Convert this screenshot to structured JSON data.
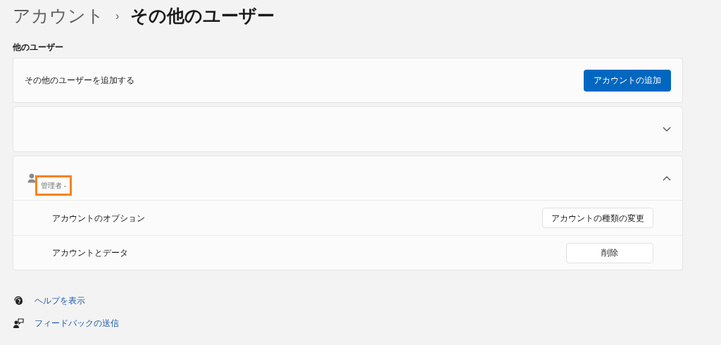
{
  "breadcrumb": {
    "parent": "アカウント",
    "separator": "›",
    "current": "その他のユーザー"
  },
  "section_title": "他のユーザー",
  "add_user": {
    "label": "その他のユーザーを追加する",
    "button": "アカウントの追加"
  },
  "users": [
    {
      "expanded": false
    },
    {
      "expanded": true,
      "role": "管理者 -",
      "highlighted": true,
      "settings": [
        {
          "label": "アカウントのオプション",
          "button": "アカウントの種類の変更"
        },
        {
          "label": "アカウントとデータ",
          "button": "削除"
        }
      ]
    }
  ],
  "links": [
    {
      "kind": "help",
      "label": "ヘルプを表示"
    },
    {
      "kind": "feedback",
      "label": "フィードバックの送信"
    }
  ]
}
